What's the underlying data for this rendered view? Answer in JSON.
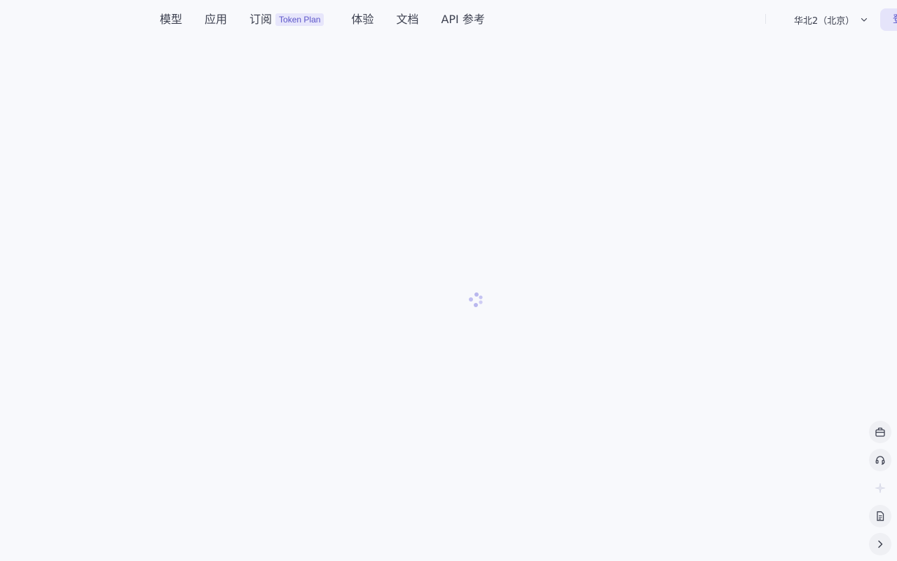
{
  "nav": {
    "items": [
      {
        "label": "模型"
      },
      {
        "label": "应用"
      },
      {
        "label": "订阅",
        "badge": "Token Plan"
      },
      {
        "label": "体验"
      },
      {
        "label": "文档"
      },
      {
        "label": "API 参考"
      }
    ]
  },
  "header": {
    "region": "华北2（北京）",
    "login_label": "登录"
  },
  "colors": {
    "background": "#f8f9fc",
    "accent": "#5b55c9",
    "badge_bg": "#e7e6fb",
    "spinner": "#b9b7ee"
  },
  "side_tools": {
    "icons": [
      "briefcase-icon",
      "headset-icon",
      "sparkle-icon",
      "document-icon",
      "chevron-right-icon"
    ]
  },
  "loading": {
    "icon": "loading-spinner-icon"
  }
}
